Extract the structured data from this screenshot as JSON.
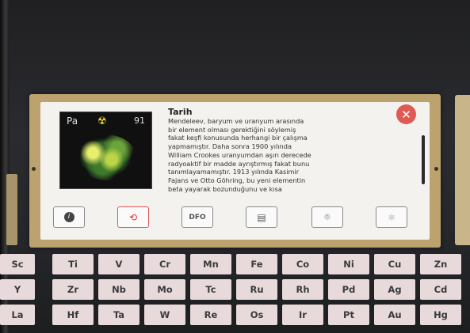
{
  "panel": {
    "title": "Tarih",
    "body": "Mendeleev, baryum ve uranyum arasında\nbir element olması gerektiğini söylemiş\nfakat keşfi konusunda herhangi bir çalışma\nyapmamıştır. Daha sonra 1900 yılında\nWilliam Crookes uranyumdan aşırı derecede\nradyoaktif bir madde ayrıştırmış fakat bunu\ntanımlayamamıştır. 1913 yılında Kasimir\nFajans ve Otto Göhring, bu yeni elementin\nbeta yayarak bozunduğunu ve kısa",
    "element_symbol": "Pa",
    "atomic_number": "91",
    "close_icon": "close-icon",
    "toolbar_icons": [
      "info-icon",
      "history-icon",
      "dfo-icon",
      "book-icon",
      "location-icon",
      "atom-icon"
    ],
    "toolbar_labels": [
      "",
      "",
      "DFO",
      "",
      "",
      ""
    ]
  },
  "periodic_table": {
    "rows": [
      [
        "Sc",
        "Ti",
        "V",
        "Cr",
        "Mn",
        "Fe",
        "Co",
        "Ni",
        "Cu",
        "Zn"
      ],
      [
        "Y",
        "Zr",
        "Nb",
        "Mo",
        "Tc",
        "Ru",
        "Rh",
        "Pd",
        "Ag",
        "Cd"
      ],
      [
        "La",
        "Hf",
        "Ta",
        "W",
        "Re",
        "Os",
        "Ir",
        "Pt",
        "Au",
        "Hg"
      ]
    ]
  },
  "colors": {
    "panel_border": "#bca26f",
    "panel_background": "#f4f2ef",
    "close_button": "#e05a55",
    "cell_background": "#e8dadb",
    "screen_background": "#26272a"
  }
}
